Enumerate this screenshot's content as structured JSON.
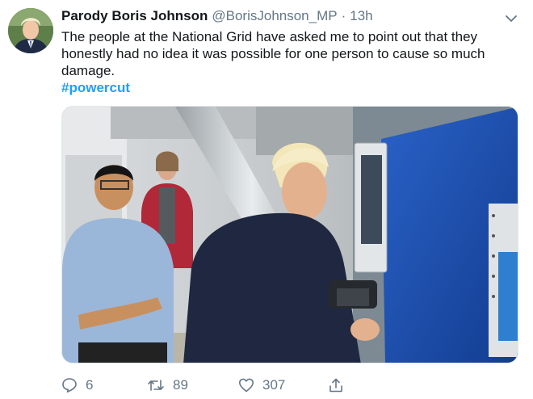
{
  "tweet": {
    "author_name": "Parody Boris Johnson",
    "handle": "@BorisJohnson_MP",
    "separator": "·",
    "time": "13h",
    "text": "The people at the National Grid have asked me to point out that they honestly had no idea it was possible for one person to cause so much damage.",
    "hashtag": "#powercut",
    "replies": "6",
    "retweets": "89",
    "likes": "307"
  },
  "icons": {
    "menu": "chevron-down-icon",
    "reply": "speech-bubble-icon",
    "retweet": "retweet-arrows-icon",
    "like": "heart-icon",
    "share": "share-upload-icon"
  },
  "colors": {
    "link": "#1da1f2",
    "muted": "#657786",
    "text": "#14171a"
  }
}
